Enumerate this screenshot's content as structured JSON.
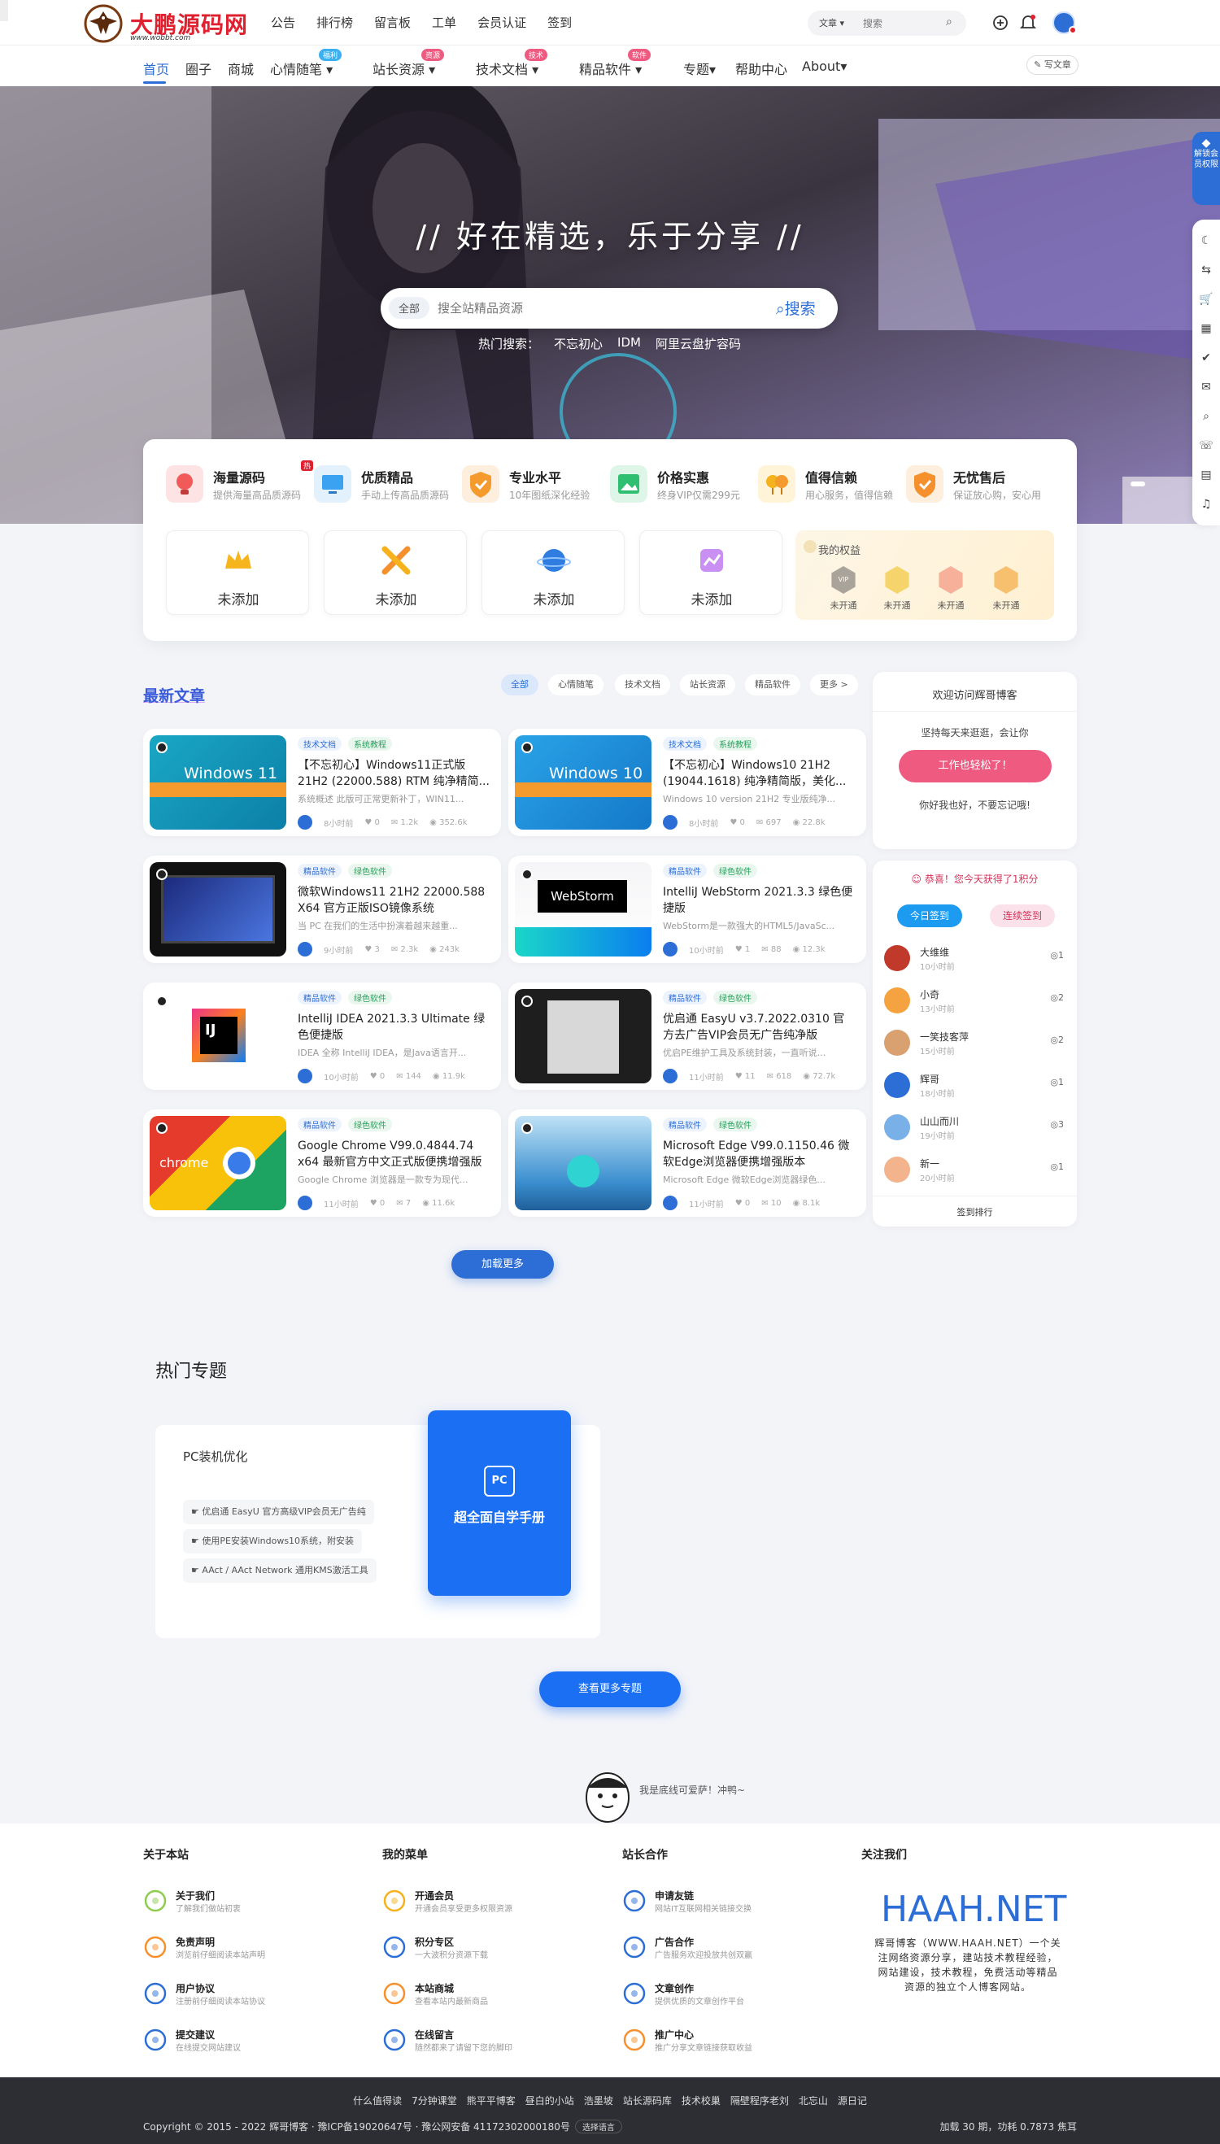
{
  "brand": {
    "name": "大鹏源码网",
    "url": "www.wobbt.com"
  },
  "topnav": [
    "公告",
    "排行榜",
    "留言板",
    "工单",
    "会员认证",
    "签到"
  ],
  "top_search": {
    "type": "文章",
    "placeholder": "搜索"
  },
  "mainnav": {
    "items": [
      "首页",
      "圈子",
      "商城",
      "心情随笔",
      "站长资源",
      "技术文档",
      "精品软件",
      "专题",
      "帮助中心",
      "About"
    ],
    "badges": {
      "mood": "福利",
      "res": "资源",
      "tech": "技术",
      "soft": "软件"
    },
    "post_button": "写文章"
  },
  "hero": {
    "slogan": "// 好在精选，乐于分享 //",
    "search_scope": "全部",
    "search_placeholder": "搜全站精品资源",
    "search_button": "搜索",
    "hot_label": "热门搜索：",
    "hot_terms": [
      "不忘初心",
      "IDM",
      "阿里云盘扩容码"
    ]
  },
  "features": [
    {
      "title": "海量源码",
      "desc": "提供海量高品质源码",
      "tag": "热"
    },
    {
      "title": "优质精品",
      "desc": "手动上传高品质源码"
    },
    {
      "title": "专业水平",
      "desc": "10年图纸深化经验"
    },
    {
      "title": "价格实惠",
      "desc": "终身VIP仅需299元"
    },
    {
      "title": "值得信赖",
      "desc": "用心服务，值得信赖"
    },
    {
      "title": "无忧售后",
      "desc": "保证放心购，安心用"
    }
  ],
  "slots": [
    "未添加",
    "未添加",
    "未添加",
    "未添加"
  ],
  "rights": {
    "title": "我的权益",
    "items": [
      "未开通",
      "未开通",
      "未开通",
      "未开通"
    ],
    "badges": [
      "VIP",
      "",
      "",
      ""
    ]
  },
  "latest": {
    "title": "最新文章",
    "filters": [
      "全部",
      "心情随笔",
      "技术文档",
      "站长资源",
      "精品软件",
      "更多 >"
    ],
    "posts": [
      {
        "tags": [
          "技术文档",
          "系统教程"
        ],
        "title": "【不忘初心】Windows11正式版21H2 (22000.588) RTM 纯净精简...",
        "excerpt": "系统概述 此版可正常更新补丁，WIN11...",
        "author": "8小时前",
        "likes": "0",
        "views": "1.2k",
        "hot": "352.6k",
        "thumb": "win11",
        "thumb_text": "Windows 11"
      },
      {
        "tags": [
          "技术文档",
          "系统教程"
        ],
        "title": "【不忘初心】Windows10 21H2 (19044.1618) 纯净精简版，美化...",
        "excerpt": "Windows 10 version 21H2 专业版纯净...",
        "author": "8小时前",
        "likes": "0",
        "views": "697",
        "hot": "22.8k",
        "thumb": "win10",
        "thumb_text": "Windows 10"
      },
      {
        "tags": [
          "精品软件",
          "绿色软件"
        ],
        "title": "微软Windows11 21H2 22000.588 X64 官方正版ISO镜像系统",
        "excerpt": "当 PC 在我们的生活中扮演着越来越重...",
        "author": "9小时前",
        "likes": "3",
        "views": "2.3k",
        "hot": "243k",
        "thumb": "laptop"
      },
      {
        "tags": [
          "精品软件",
          "绿色软件"
        ],
        "title": "IntelliJ WebStorm 2021.3.3 绿色便捷版",
        "excerpt": "WebStorm是一款强大的HTML5/JavaSc...",
        "author": "10小时前",
        "likes": "1",
        "views": "88",
        "hot": "12.3k",
        "thumb": "webstorm",
        "thumb_text": "WebStorm"
      },
      {
        "tags": [
          "精品软件",
          "绿色软件"
        ],
        "title": "IntelliJ IDEA 2021.3.3 Ultimate 绿色便捷版",
        "excerpt": "IDEA 全称 IntelliJ IDEA，是Java语言开...",
        "author": "10小时前",
        "likes": "0",
        "views": "144",
        "hot": "11.9k",
        "thumb": "idea",
        "thumb_text": "IJ"
      },
      {
        "tags": [
          "精品软件",
          "绿色软件"
        ],
        "title": "优启通 EasyU v3.7.2022.0310 官方去广告VIP会员无广告纯净版",
        "excerpt": "优启PE维护工具及系统封装，一直听说...",
        "author": "11小时前",
        "likes": "11",
        "views": "618",
        "hot": "72.7k",
        "thumb": "easyu"
      },
      {
        "tags": [
          "精品软件",
          "绿色软件"
        ],
        "title": "Google Chrome V99.0.4844.74 x64 最新官方中文正式版便携增强版",
        "excerpt": "Google Chrome 浏览器是一款专为现代...",
        "author": "11小时前",
        "likes": "0",
        "views": "7",
        "hot": "11.6k",
        "thumb": "chrome",
        "thumb_text": "chrome"
      },
      {
        "tags": [
          "精品软件",
          "绿色软件"
        ],
        "title": "Microsoft Edge V99.0.1150.46 微软Edge浏览器便携增强版本",
        "excerpt": "Microsoft Edge 微软Edge浏览器绿色...",
        "author": "11小时前",
        "likes": "0",
        "views": "10",
        "hot": "8.1k",
        "thumb": "edge"
      }
    ],
    "load_more": "加载更多"
  },
  "welcome": {
    "title": "欢迎访问辉哥博客",
    "line1": "坚持每天来逛逛，会让你",
    "button": "工作也轻松了！",
    "line2": "你好我也好，不要忘记哦!"
  },
  "checkin": {
    "title": "恭喜！您今天获得了1积分",
    "btn_today": "今日签到",
    "btn_streak": "连续签到",
    "users": [
      {
        "name": "大维维",
        "time": "10小时前",
        "n": "1"
      },
      {
        "name": "小奇",
        "time": "13小时前",
        "n": "2"
      },
      {
        "name": "一笑技客萍",
        "time": "15小时前",
        "n": "2"
      },
      {
        "name": "辉哥",
        "time": "18小时前",
        "n": "1"
      },
      {
        "name": "山山而川",
        "time": "19小时前",
        "n": "3"
      },
      {
        "name": "新一",
        "time": "20小时前",
        "n": "1"
      }
    ],
    "footer": "签到排行"
  },
  "topics": {
    "title": "热门专题",
    "card_name": "PC装机优化",
    "links": [
      "优启通 EasyU 官方高级VIP会员无广告纯",
      "使用PE安装Windows10系统，附安装",
      "AAct / AAct Network 通用KMS激活工具"
    ],
    "feature_icon": "PC",
    "feature_title": "超全面自学手册",
    "more": "查看更多专题"
  },
  "bottom_line": "我是底线可爱萨！冲鸭~",
  "footer": {
    "cols": [
      {
        "title": "关于本站",
        "items": [
          {
            "t": "关于我们",
            "d": "了解我们做站初衷"
          },
          {
            "t": "免责声明",
            "d": "浏览前仔细阅读本站声明"
          },
          {
            "t": "用户协议",
            "d": "注册前仔细阅读本站协议"
          },
          {
            "t": "提交建议",
            "d": "在线提交网站建议"
          }
        ]
      },
      {
        "title": "我的菜单",
        "items": [
          {
            "t": "开通会员",
            "d": "开通会员享受更多权限资源"
          },
          {
            "t": "积分专区",
            "d": "一大波积分资源下载"
          },
          {
            "t": "本站商城",
            "d": "查看本站内最新商品"
          },
          {
            "t": "在线留言",
            "d": "随然都来了请留下您的脚印"
          }
        ]
      },
      {
        "title": "站长合作",
        "items": [
          {
            "t": "申请友链",
            "d": "网站IT互联网相关链接交换"
          },
          {
            "t": "广告合作",
            "d": "广告服务欢迎投放共创双赢"
          },
          {
            "t": "文章创作",
            "d": "提供优质的文章创作平台"
          },
          {
            "t": "推广中心",
            "d": "推广分享文章链接获取收益"
          }
        ]
      },
      {
        "title": "关注我们"
      }
    ],
    "follow_brand": "HAAH.NET",
    "follow_desc": "辉哥博客（WWW.HAAH.NET）一个关注网络资源分享，建站技术教程经验，网站建设，技术教程，免费活动等精品资源的独立个人博客网站。"
  },
  "copyright": {
    "links": [
      "什么值得读",
      "7分钟课堂",
      "熊平平博客",
      "昼白的小站",
      "浩墨坡",
      "站长源码库",
      "技术校巢",
      "隔壁程序老刘",
      "北忘山",
      "源日记"
    ],
    "left": "Copyright © 2015 - 2022 辉哥博客 · 豫ICP备19020647号 · 豫公网安备 41172302000180号",
    "select": "选择语言",
    "right": "加载 30 期，功耗 0.7873 焦耳"
  },
  "rail": {
    "vip": "解锁会员权限",
    "buttons": [
      "☾",
      "⇆",
      "🛒",
      "▦",
      "✔",
      "✉",
      "⌕",
      "☏",
      "▤",
      "♫"
    ]
  },
  "colors": {
    "accent": "#2c6ed5",
    "brand_red": "#e0202e",
    "pink": "#ee5a80"
  }
}
